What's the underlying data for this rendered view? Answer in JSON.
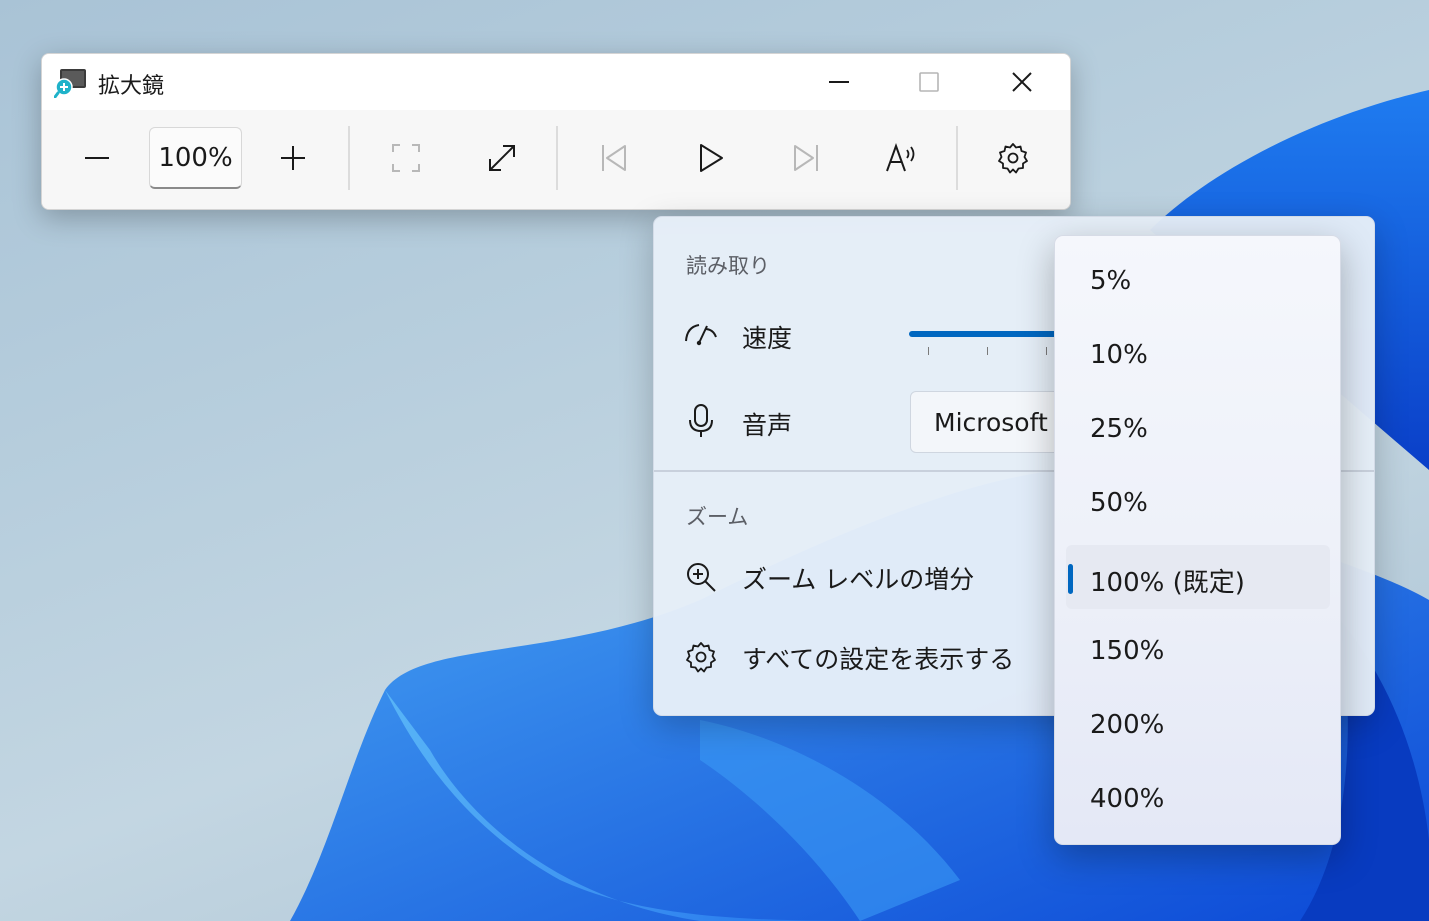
{
  "window": {
    "title": "拡大鏡"
  },
  "toolbar": {
    "zoom_value": "100%",
    "buttons": {
      "zoom_out": "minus-icon",
      "zoom_in": "plus-icon",
      "fit_view": "full-screen-corners-icon",
      "expand": "expand-arrows-icon",
      "previous": "skip-back-icon",
      "play": "play-icon",
      "next": "skip-forward-icon",
      "read_from_here": "read-aloud-icon",
      "settings": "gear-icon"
    }
  },
  "flyout": {
    "reading_section": "読み取り",
    "speed_label": "速度",
    "voice_label": "音声",
    "voice_value": "Microsoft",
    "zoom_section": "ズーム",
    "zoom_increment_label": "ズーム レベルの増分",
    "all_settings_label": "すべての設定を表示する"
  },
  "dropdown": {
    "options": [
      "5%",
      "10%",
      "25%",
      "50%",
      "100% (既定)",
      "150%",
      "200%",
      "400%"
    ],
    "selected_index": 4
  },
  "colors": {
    "accent": "#0067c0"
  }
}
